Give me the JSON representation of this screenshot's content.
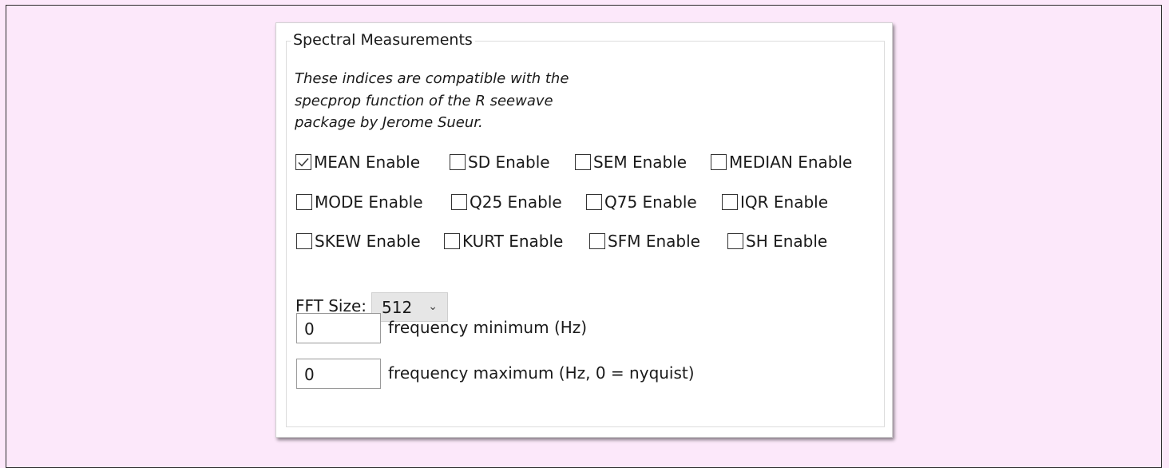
{
  "group": {
    "title": "Spectral Measurements",
    "description_lines": [
      "These indices are compatible with the",
      "specprop function of the R seewave",
      "package by Jerome Sueur."
    ]
  },
  "checkboxes": [
    {
      "label": "MEAN Enable",
      "checked": true
    },
    {
      "label": "SD Enable",
      "checked": false
    },
    {
      "label": "SEM Enable",
      "checked": false
    },
    {
      "label": "MEDIAN Enable",
      "checked": false
    },
    {
      "label": "MODE Enable",
      "checked": false
    },
    {
      "label": "Q25 Enable",
      "checked": false
    },
    {
      "label": "Q75 Enable",
      "checked": false
    },
    {
      "label": "IQR Enable",
      "checked": false
    },
    {
      "label": "SKEW Enable",
      "checked": false
    },
    {
      "label": "KURT Enable",
      "checked": false
    },
    {
      "label": "SFM Enable",
      "checked": false
    },
    {
      "label": "SH Enable",
      "checked": false
    }
  ],
  "fft": {
    "label": "FFT Size:",
    "value": "512"
  },
  "freq_min": {
    "value": "0",
    "label": "frequency minimum (Hz)"
  },
  "freq_max": {
    "value": "0",
    "label": "frequency maximum (Hz, 0 = nyquist)"
  }
}
